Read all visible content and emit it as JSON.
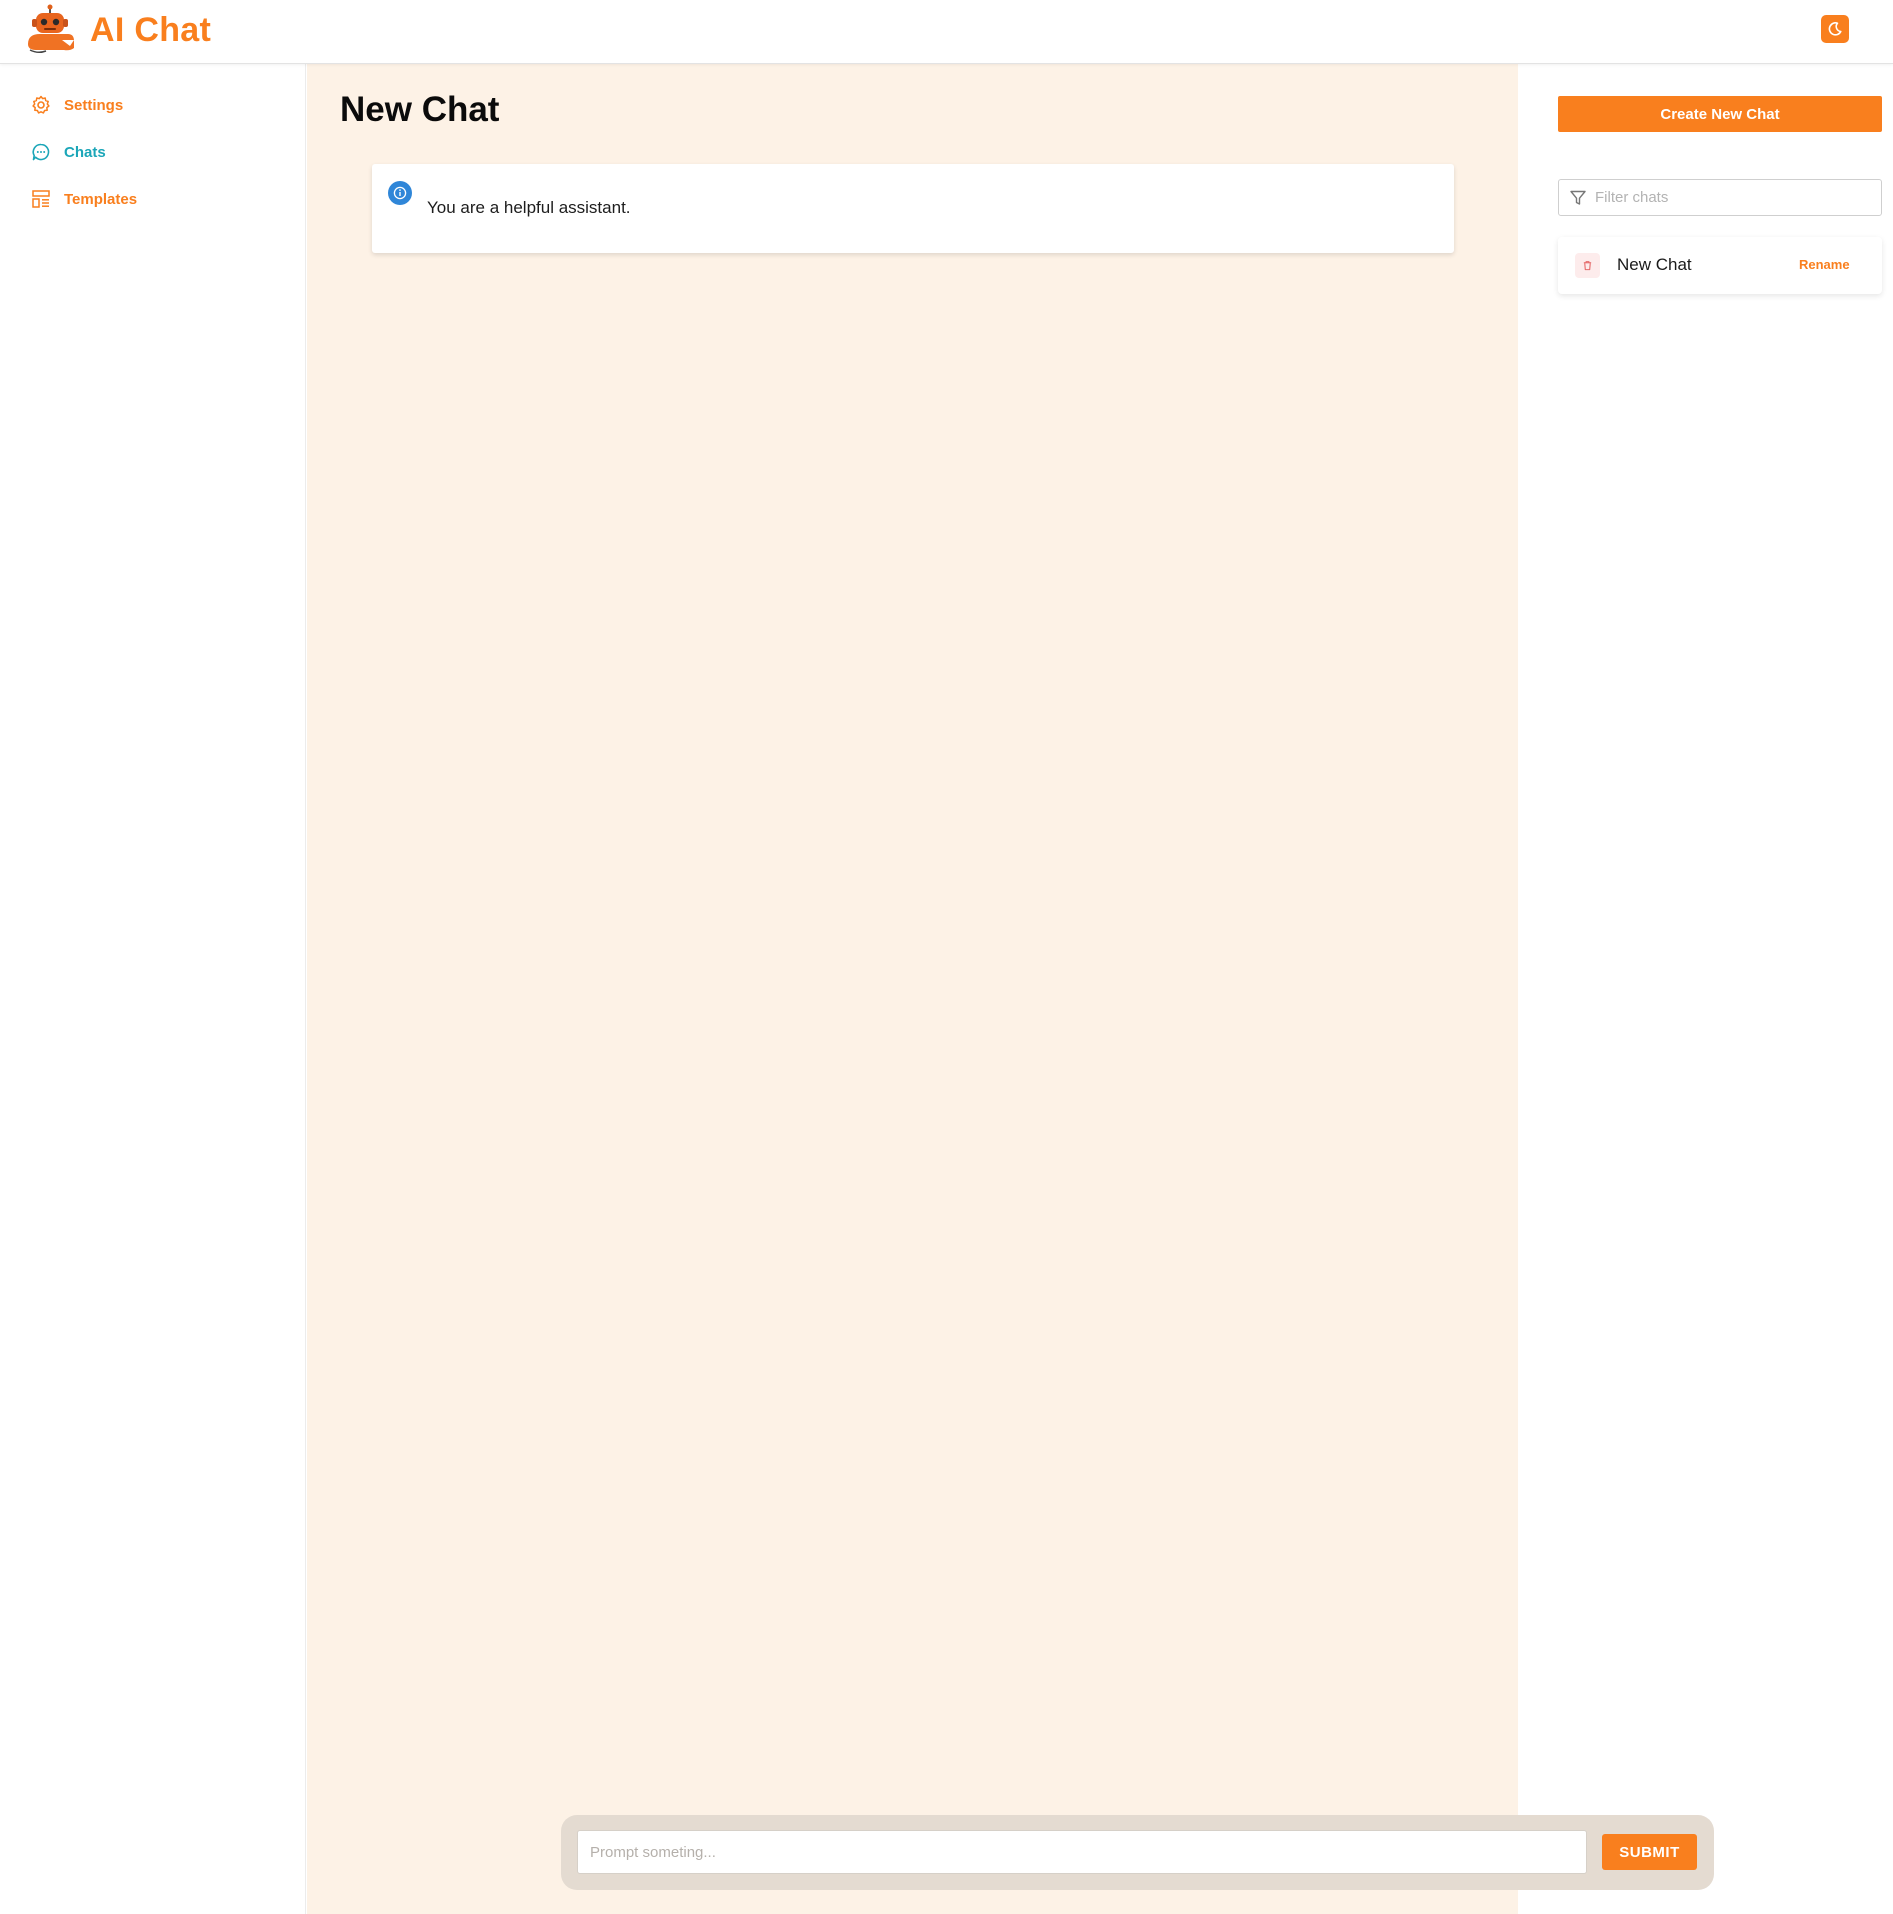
{
  "app": {
    "name": "AI Chat",
    "accent_color": "#f97f1e",
    "logo_icon": "robot-mascot-icon",
    "theme_toggle_icon": "moon-icon"
  },
  "sidebar": {
    "items": [
      {
        "label": "Settings",
        "icon": "gear-icon",
        "color": "#f97f1e"
      },
      {
        "label": "Chats",
        "icon": "chat-bubble-icon",
        "color": "#1ba6b8",
        "active": true
      },
      {
        "label": "Templates",
        "icon": "template-layout-icon",
        "color": "#f97f1e"
      }
    ]
  },
  "main": {
    "title": "New Chat",
    "background_color": "#fdf2e6",
    "system_message": {
      "icon": "info-icon",
      "text": "You are a helpful assistant."
    },
    "prompt": {
      "placeholder": "Prompt someting...",
      "value": "",
      "submit_label": "SUBMIT"
    }
  },
  "right_panel": {
    "create_label": "Create New Chat",
    "filter": {
      "placeholder": "Filter chats",
      "value": "",
      "icon": "filter-funnel-icon"
    },
    "chats": [
      {
        "title": "New Chat",
        "delete_icon": "trash-icon",
        "rename_label": "Rename"
      }
    ]
  }
}
